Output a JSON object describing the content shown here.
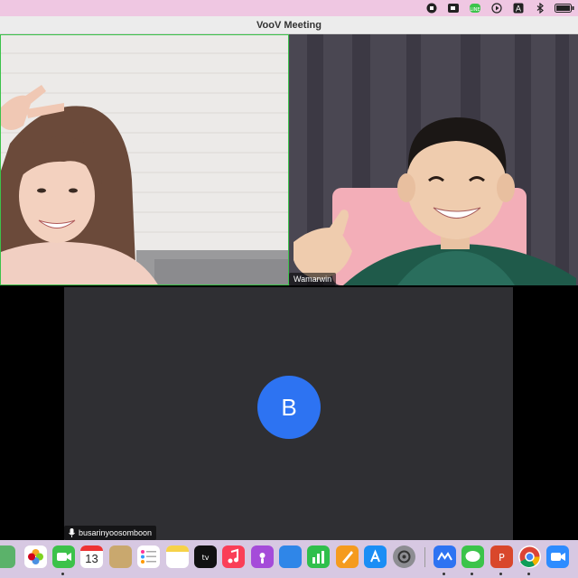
{
  "window": {
    "title": "VooV Meeting"
  },
  "participants": [
    {
      "name": ""
    },
    {
      "name": "Wamarwin"
    },
    {
      "name": "busarinyoosomboon",
      "initial": "B"
    }
  ],
  "calendar": {
    "day": "13"
  },
  "colors": {
    "accent_blue": "#2d73f2",
    "active_speaker": "#3cc24a"
  },
  "tray_icons": [
    "record-icon",
    "camera-icon",
    "line-icon",
    "play-icon",
    "a-icon",
    "bluetooth-icon",
    "battery-icon"
  ]
}
